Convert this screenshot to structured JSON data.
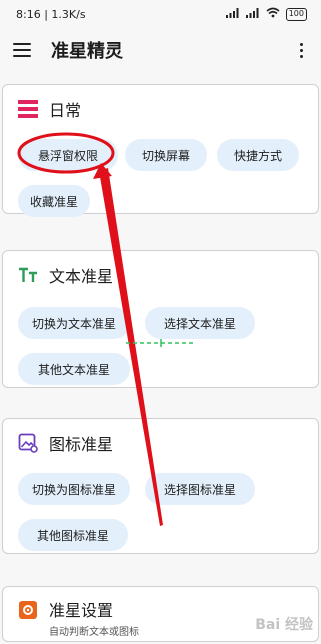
{
  "status": {
    "time": "8:16",
    "speed": "1.3K/s",
    "battery": "100"
  },
  "app": {
    "title": "准星精灵"
  },
  "sections": {
    "daily": {
      "title": "日常",
      "chips": [
        "悬浮窗权限",
        "切换屏幕",
        "快捷方式",
        "收藏准星"
      ]
    },
    "text_crosshair": {
      "title": "文本准星",
      "chips": [
        "切换为文本准星",
        "选择文本准星",
        "其他文本准星"
      ]
    },
    "icon_crosshair": {
      "title": "图标准星",
      "chips": [
        "切换为图标准星",
        "选择图标准星",
        "其他图标准星"
      ]
    },
    "settings": {
      "title": "准星设置",
      "subtitle": "自动判断文本或图标"
    }
  },
  "colors": {
    "daily_icon": "#e0245e",
    "text_icon": "#2e9d5a",
    "icon_icon": "#6a3fbf",
    "settings_icon": "#e8641c",
    "annotation_red": "#e0101a",
    "chip_bg": "#e3effa"
  },
  "watermark": {
    "text": "Bai 经验"
  }
}
